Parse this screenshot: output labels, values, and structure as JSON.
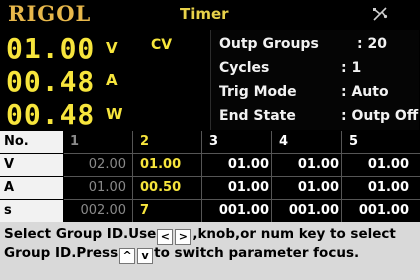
{
  "header": {
    "logo": "RIGOL",
    "title": "Timer",
    "usb_icon": "usb-icon"
  },
  "measurements": {
    "voltage": {
      "value": "01.00",
      "unit": "V"
    },
    "mode": "CV",
    "current": {
      "value": "00.48",
      "unit": "A"
    },
    "power": {
      "value": "00.48",
      "unit": "W"
    }
  },
  "settings": [
    {
      "label": "Outp Groups",
      "value": ": 20"
    },
    {
      "label": "Cycles",
      "value": ": 1"
    },
    {
      "label": "Trig Mode",
      "value": ": Auto"
    },
    {
      "label": "End State",
      "value": ": Outp Off"
    }
  ],
  "table": {
    "headers": [
      "No.",
      "1",
      "2",
      "3",
      "4",
      "5"
    ],
    "rows": [
      {
        "label": "V",
        "cells": [
          "02.00",
          "01.00",
          "01.00",
          "01.00",
          "01.00"
        ]
      },
      {
        "label": "A",
        "cells": [
          "01.00",
          "00.50",
          "01.00",
          "01.00",
          "01.00"
        ]
      },
      {
        "label": "s",
        "cells": [
          "002.00",
          "7",
          "001.00",
          "001.00",
          "001.00"
        ]
      }
    ]
  },
  "help": {
    "part1": "Select Group ID.Use",
    "part2": ",knob,or num key to select Group ID.Press",
    "part3": "to switch parameter focus.",
    "arrow_left": "<",
    "arrow_right": ">",
    "arrow_up": "^",
    "arrow_down": "v"
  },
  "colors": {
    "accent": "#f7e53c",
    "selected_text": "#f7e53c",
    "disabled_text": "#8a8a8a",
    "help_bg": "#d9d9d9"
  }
}
